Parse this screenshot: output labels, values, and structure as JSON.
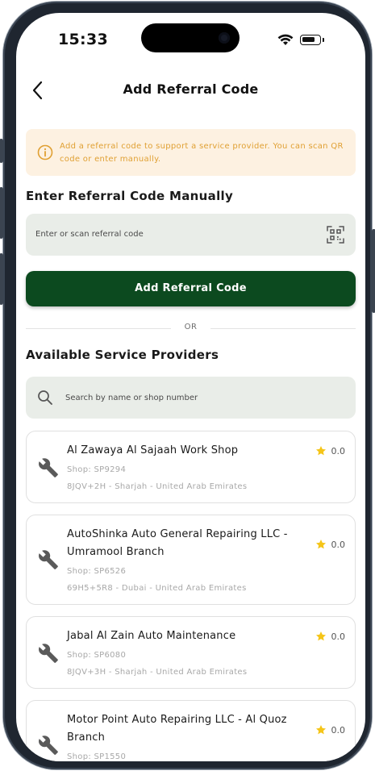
{
  "status_bar": {
    "time": "15:33"
  },
  "header": {
    "title": "Add Referral Code"
  },
  "info_banner": {
    "text": "Add a referral code to support a service provider. You can scan QR code or enter manually."
  },
  "manual_section": {
    "heading": "Enter Referral Code Manually",
    "input_placeholder": "Enter or scan referral code",
    "button_label": "Add Referral Code"
  },
  "divider": {
    "label": "OR"
  },
  "providers_section": {
    "heading": "Available Service Providers",
    "search_placeholder": "Search by name or shop number",
    "providers": [
      {
        "name": "Al Zawaya Al Sajaah Work Shop",
        "shop": "Shop: SP9294",
        "address": "8JQV+2H - Sharjah - United Arab Emirates",
        "rating": "0.0"
      },
      {
        "name": "AutoShinka Auto General Repairing LLC -Umramool Branch",
        "shop": "Shop: SP6526",
        "address": "69H5+5R8 - Dubai - United Arab Emirates",
        "rating": "0.0"
      },
      {
        "name": "Jabal Al Zain Auto Maintenance",
        "shop": "Shop: SP6080",
        "address": "8JQV+3H - Sharjah - United Arab Emirates",
        "rating": "0.0"
      },
      {
        "name": "Motor Point Auto Repairing LLC - Al Quoz Branch",
        "shop": "Shop: SP1550",
        "address": "",
        "rating": "0.0"
      }
    ]
  },
  "icons": {
    "back": "chevron-left-icon",
    "info": "info-circle-icon",
    "qr": "qr-scan-icon",
    "search": "search-icon",
    "provider": "wrench-icon",
    "rating": "star-icon"
  },
  "colors": {
    "primary": "#0c4a1f",
    "info_bg": "#fdf1e1",
    "info_text": "#e0a033",
    "input_bg": "#e9ede8",
    "star": "#f5c518"
  }
}
